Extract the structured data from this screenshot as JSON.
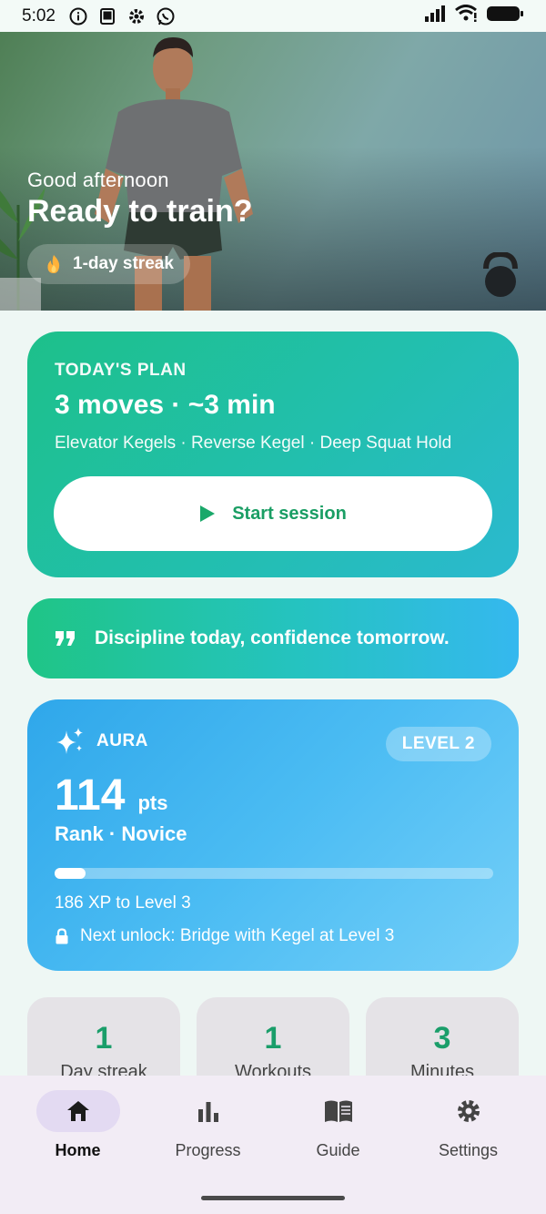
{
  "status_bar": {
    "time": "5:02",
    "left_icons": [
      "info-icon",
      "screen-icon",
      "settings-gear-icon",
      "whatsapp-icon"
    ],
    "right_icons": [
      "signal-icon",
      "wifi-icon",
      "battery-icon"
    ]
  },
  "hero": {
    "greeting": "Good afternoon",
    "title": "Ready to train?",
    "streak": "1-day streak"
  },
  "plan": {
    "kicker": "TODAY'S PLAN",
    "title": "3 moves · ~3 min",
    "moves": "Elevator Kegels · Reverse Kegel · Deep Squat Hold",
    "cta": "Start session"
  },
  "quote": {
    "text": "Discipline today, confidence tomorrow."
  },
  "aura": {
    "label": "AURA",
    "level": "LEVEL 2",
    "points": "114",
    "points_unit": "pts",
    "rank": "Rank · Novice",
    "progress_fraction": 0.07,
    "xp_text": "186 XP to Level 3",
    "next_unlock": "Next unlock: Bridge with Kegel at Level 3"
  },
  "stats": [
    {
      "value": "1",
      "label": "Day streak"
    },
    {
      "value": "1",
      "label": "Workouts"
    },
    {
      "value": "3",
      "label": "Minutes"
    }
  ],
  "nav": [
    {
      "label": "Home",
      "icon": "home-icon",
      "active": true
    },
    {
      "label": "Progress",
      "icon": "bar-chart-icon",
      "active": false
    },
    {
      "label": "Guide",
      "icon": "book-icon",
      "active": false
    },
    {
      "label": "Settings",
      "icon": "gear-icon",
      "active": false
    }
  ],
  "colors": {
    "accent_green": "#1a9e64",
    "plan_gradient_start": "#1dc08a",
    "aura_blue": "#2fa7ea",
    "nav_active": "#e3daf2"
  }
}
